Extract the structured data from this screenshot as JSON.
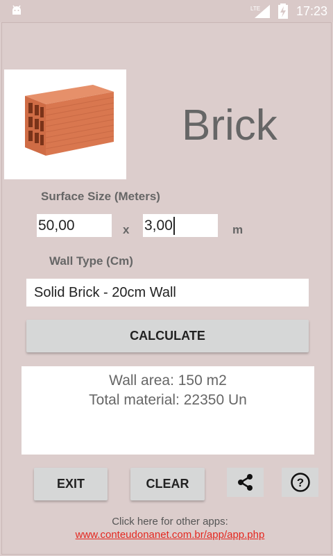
{
  "status_bar": {
    "time": "17:23",
    "network": "LTE"
  },
  "header": {
    "title": "Brick"
  },
  "form": {
    "surface_label": "Surface Size (Meters)",
    "width_value": "50,00",
    "height_value": "3,00",
    "separator": "x",
    "unit": "m",
    "wall_type_label": "Wall Type (Cm)",
    "wall_type_selected": "Solid Brick - 20cm Wall"
  },
  "actions": {
    "calculate_label": "CALCULATE",
    "exit_label": "EXIT",
    "clear_label": "CLEAR"
  },
  "result": {
    "wall_area": "Wall area: 150 m2",
    "total_material": "Total material: 22350 Un"
  },
  "footer": {
    "text": "Click here for other apps:",
    "link": "www.conteudonanet.com.br/app/app.php"
  },
  "icons": {
    "android": "android-icon",
    "lte": "lte-icon",
    "signal": "signal-icon",
    "battery": "battery-charging-icon",
    "share": "share-icon",
    "help": "help-icon"
  }
}
